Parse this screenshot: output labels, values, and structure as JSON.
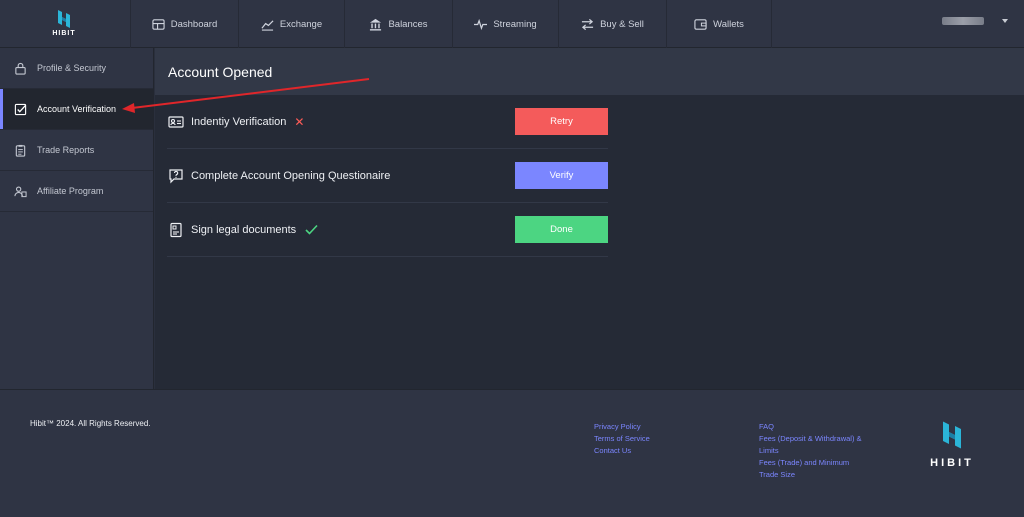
{
  "brand": {
    "logo_text": "HIBIT",
    "accent": "#7b86ff"
  },
  "nav": {
    "items": [
      {
        "label": "Dashboard",
        "icon": "dashboard-icon"
      },
      {
        "label": "Exchange",
        "icon": "exchange-chart-icon"
      },
      {
        "label": "Balances",
        "icon": "bank-icon"
      },
      {
        "label": "Streaming",
        "icon": "pulse-icon"
      },
      {
        "label": "Buy & Sell",
        "icon": "swap-arrows-icon"
      },
      {
        "label": "Wallets",
        "icon": "wallet-icon"
      }
    ]
  },
  "sidebar": {
    "items": [
      {
        "label": "Profile & Security",
        "icon": "lock-icon",
        "active": false
      },
      {
        "label": "Account Verification",
        "icon": "checkbox-icon",
        "active": true
      },
      {
        "label": "Trade Reports",
        "icon": "clipboard-icon",
        "active": false
      },
      {
        "label": "Affiliate Program",
        "icon": "users-icon",
        "active": false
      }
    ]
  },
  "main": {
    "title": "Account Opened",
    "rows": [
      {
        "label": "Indentiy Verification",
        "icon": "id-card-icon",
        "status": "failed",
        "button": "Retry"
      },
      {
        "label": "Complete Account Opening Questionaire",
        "icon": "question-bubble-icon",
        "status": "pending",
        "button": "Verify"
      },
      {
        "label": "Sign legal documents",
        "icon": "document-icon",
        "status": "done",
        "button": "Done"
      }
    ],
    "status_colors": {
      "retry": "#f45b5b",
      "verify": "#7b86ff",
      "done": "#4cd582"
    }
  },
  "footer": {
    "copyright": "Hibit™ 2024. All Rights Reserved.",
    "links_col1": [
      "Privacy Policy",
      "Terms of Service",
      "Contact Us"
    ],
    "links_col2": [
      "FAQ",
      "Fees (Deposit & Withdrawal) & Limits",
      "Fees (Trade) and Minimum Trade Size"
    ],
    "logo_text": "HIBIT"
  }
}
